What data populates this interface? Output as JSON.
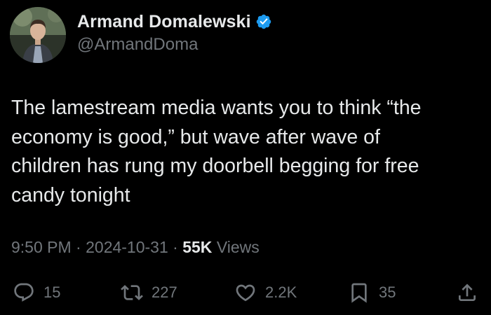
{
  "author": {
    "display_name": "Armand Domalewski",
    "handle": "@ArmandDoma",
    "verified": true,
    "verified_color": "#1d9bf0"
  },
  "tweet": {
    "text": "The lamestream media wants you to think “the\neconomy is good,” but wave after wave of\nchildren has rung my doorbell begging for free\ncandy tonight"
  },
  "meta": {
    "time": "9:50 PM",
    "separator": "·",
    "date": "2024-10-31",
    "views_count": "55K",
    "views_label": "Views"
  },
  "actions": {
    "reply": {
      "icon": "reply-icon",
      "count": "15"
    },
    "retweet": {
      "icon": "retweet-icon",
      "count": "227"
    },
    "like": {
      "icon": "heart-icon",
      "count": "2.2K"
    },
    "bookmark": {
      "icon": "bookmark-icon",
      "count": "35"
    },
    "share": {
      "icon": "share-icon"
    }
  },
  "colors": {
    "background": "#000000",
    "primary_text": "#e7e9ea",
    "secondary_text": "#71767b"
  }
}
